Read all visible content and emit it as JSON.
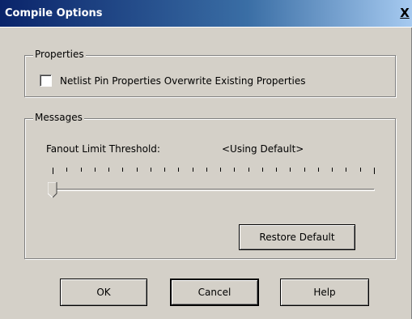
{
  "window": {
    "title": "Compile Options",
    "close_label": "X"
  },
  "properties_group": {
    "legend": "Properties",
    "checkbox_label": "Netlist Pin Properties Overwrite Existing Properties",
    "checked": false
  },
  "messages_group": {
    "legend": "Messages",
    "fanout_label": "Fanout Limit Threshold:",
    "fanout_value": "<Using Default>",
    "slider_position": 0,
    "restore_label": "Restore Default"
  },
  "buttons": {
    "ok": "OK",
    "cancel": "Cancel",
    "help": "Help"
  },
  "colors": {
    "dialog_bg": "#d4d0c8",
    "title_start": "#0a246a",
    "title_end": "#a6caf0"
  }
}
